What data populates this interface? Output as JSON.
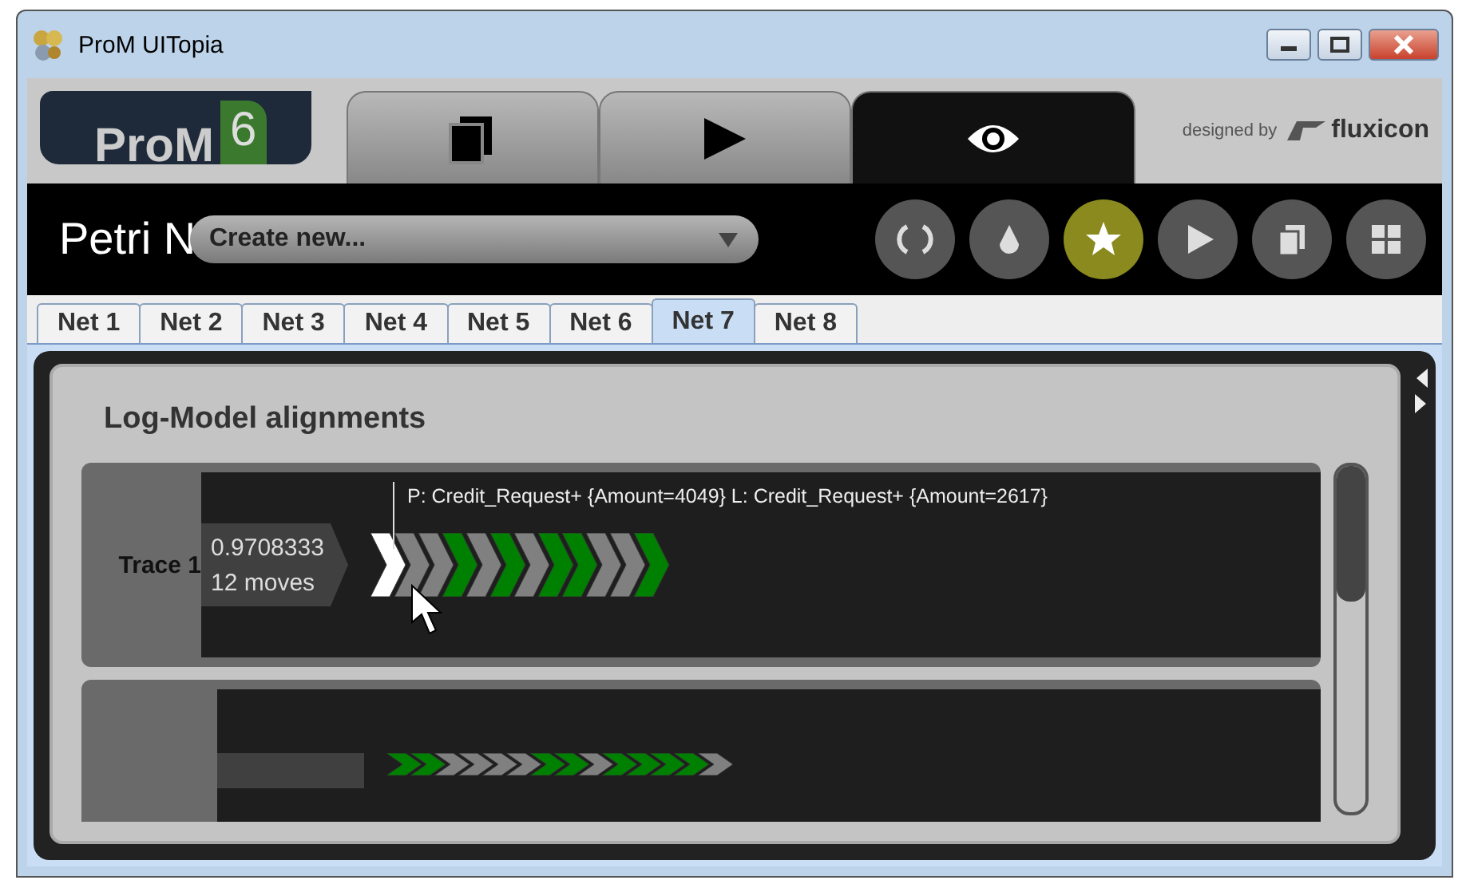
{
  "window": {
    "title": "ProM UITopia"
  },
  "header": {
    "logo": "ProM",
    "version": "6",
    "credit_prefix": "designed by",
    "credit_brand": "fluxicon",
    "tabs": [
      {
        "kind": "copy",
        "selected": false
      },
      {
        "kind": "play",
        "selected": false
      },
      {
        "kind": "view",
        "selected": true
      }
    ]
  },
  "toolbar": {
    "title": "Petri N",
    "dropdown": "Create new...",
    "buttons": [
      {
        "kind": "refresh",
        "selected": false
      },
      {
        "kind": "drop",
        "selected": false
      },
      {
        "kind": "star",
        "selected": true
      },
      {
        "kind": "play",
        "selected": false
      },
      {
        "kind": "copy",
        "selected": false
      },
      {
        "kind": "grid",
        "selected": false
      }
    ]
  },
  "net_tabs": [
    {
      "label": "Net 1",
      "selected": false
    },
    {
      "label": "Net 2",
      "selected": false
    },
    {
      "label": "Net 3",
      "selected": false
    },
    {
      "label": "Net 4",
      "selected": false
    },
    {
      "label": "Net 5",
      "selected": false
    },
    {
      "label": "Net 6",
      "selected": false
    },
    {
      "label": "Net 7",
      "selected": true
    },
    {
      "label": "Net 8",
      "selected": false
    }
  ],
  "panel": {
    "title": "Log-Model alignments",
    "traces": [
      {
        "name": "Trace 1",
        "fitness": "0.9708333",
        "moves_count": "12 moves",
        "tooltip": "P: Credit_Request+ {Amount=4049}  L: Credit_Request+ {Amount=2617}",
        "moves": [
          {
            "color": "#ffffff"
          },
          {
            "color": "#808080"
          },
          {
            "color": "#808080"
          },
          {
            "color": "#008000"
          },
          {
            "color": "#808080"
          },
          {
            "color": "#008000"
          },
          {
            "color": "#808080"
          },
          {
            "color": "#008000"
          },
          {
            "color": "#008000"
          },
          {
            "color": "#808080"
          },
          {
            "color": "#808080"
          },
          {
            "color": "#008000"
          }
        ]
      },
      {
        "moves": [
          {
            "color": "#008000"
          },
          {
            "color": "#008000"
          },
          {
            "color": "#808080"
          },
          {
            "color": "#808080"
          },
          {
            "color": "#808080"
          },
          {
            "color": "#808080"
          },
          {
            "color": "#008000"
          },
          {
            "color": "#008000"
          },
          {
            "color": "#808080"
          },
          {
            "color": "#008000"
          },
          {
            "color": "#008000"
          },
          {
            "color": "#008000"
          },
          {
            "color": "#008000"
          },
          {
            "color": "#808080"
          }
        ]
      }
    ]
  }
}
